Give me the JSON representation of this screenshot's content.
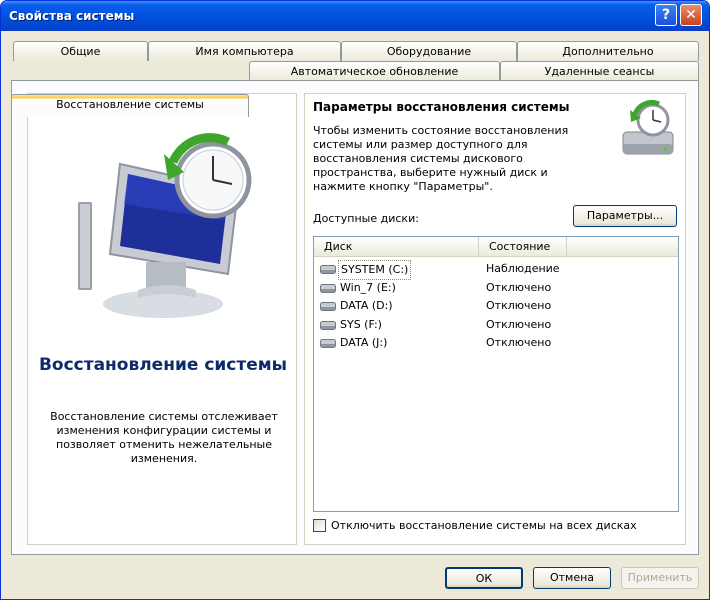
{
  "window": {
    "title": "Свойства системы"
  },
  "titlebar_buttons": {
    "help": "?",
    "close": "✕"
  },
  "tabs_row1": [
    "Общие",
    "Имя компьютера",
    "Оборудование",
    "Дополнительно"
  ],
  "tabs_row2": [
    "Восстановление системы",
    "Автоматическое обновление",
    "Удаленные сеансы"
  ],
  "left": {
    "title": "Восстановление системы",
    "description": "Восстановление системы отслеживает изменения конфигурации системы и позволяет отменить нежелательные изменения."
  },
  "right": {
    "title": "Параметры восстановления системы",
    "description": "Чтобы изменить состояние восстановления системы или размер доступного для восстановления системы дискового пространства, выберите нужный диск и нажмите кнопку \"Параметры\".",
    "available_label": "Доступные диски:",
    "params_button": "Параметры...",
    "columns": [
      "Диск",
      "Состояние"
    ],
    "disks": [
      {
        "name": "SYSTEM (C:)",
        "state": "Наблюдение"
      },
      {
        "name": "Win_7 (E:)",
        "state": "Отключено"
      },
      {
        "name": "DATA (D:)",
        "state": "Отключено"
      },
      {
        "name": "SYS (F:)",
        "state": "Отключено"
      },
      {
        "name": "DATA (J:)",
        "state": "Отключено"
      }
    ],
    "disable_checkbox": "Отключить восстановление системы на всех дисках"
  },
  "footer": {
    "ok": "ОК",
    "cancel": "Отмена",
    "apply": "Применить"
  }
}
